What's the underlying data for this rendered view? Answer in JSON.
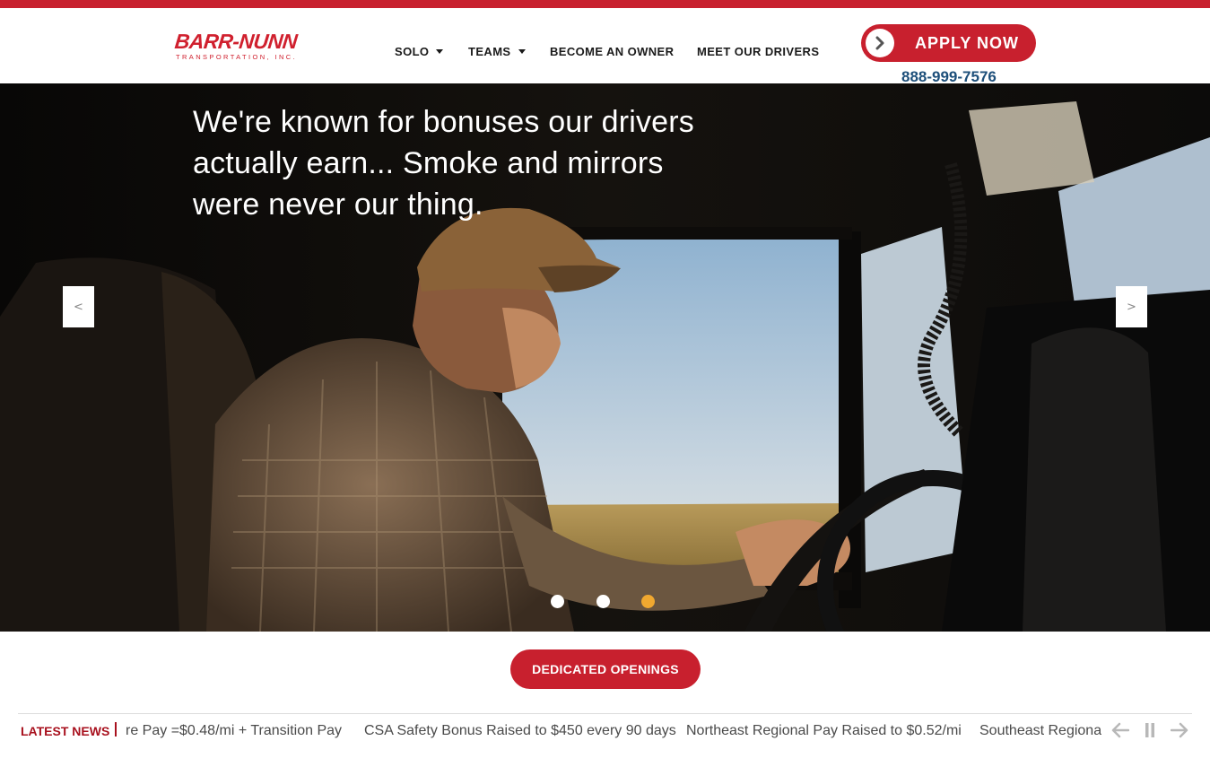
{
  "brand": {
    "name": "BARR-NUNN",
    "sub": "TRANSPORTATION, INC."
  },
  "nav": {
    "items": [
      {
        "label": "SOLO"
      },
      {
        "label": "TEAMS"
      },
      {
        "label": "BECOME AN OWNER"
      },
      {
        "label": "MEET OUR DRIVERS"
      }
    ]
  },
  "cta": {
    "apply_label": "APPLY NOW",
    "phone": "888-999-7576"
  },
  "hero": {
    "headline": "We're known for bonuses our drivers actually earn... Smoke and mirrors were never our thing.",
    "prev_label": "<",
    "next_label": ">",
    "slide_count": 3,
    "active_slide": 3
  },
  "dedicated": {
    "label": "DEDICATED OPENINGS"
  },
  "news": {
    "label": "LATEST NEWS",
    "items": [
      "re Pay =$0.48/mi + Transition Pay",
      "CSA Safety Bonus Raised to $450 every 90 days",
      "Northeast Regional Pay Raised to $0.52/mi",
      "Southeast Regional Pay Raised"
    ]
  },
  "colors": {
    "brand_red": "#c8202e",
    "phone_blue": "#1d4f7a",
    "active_dot": "#f0a830"
  }
}
